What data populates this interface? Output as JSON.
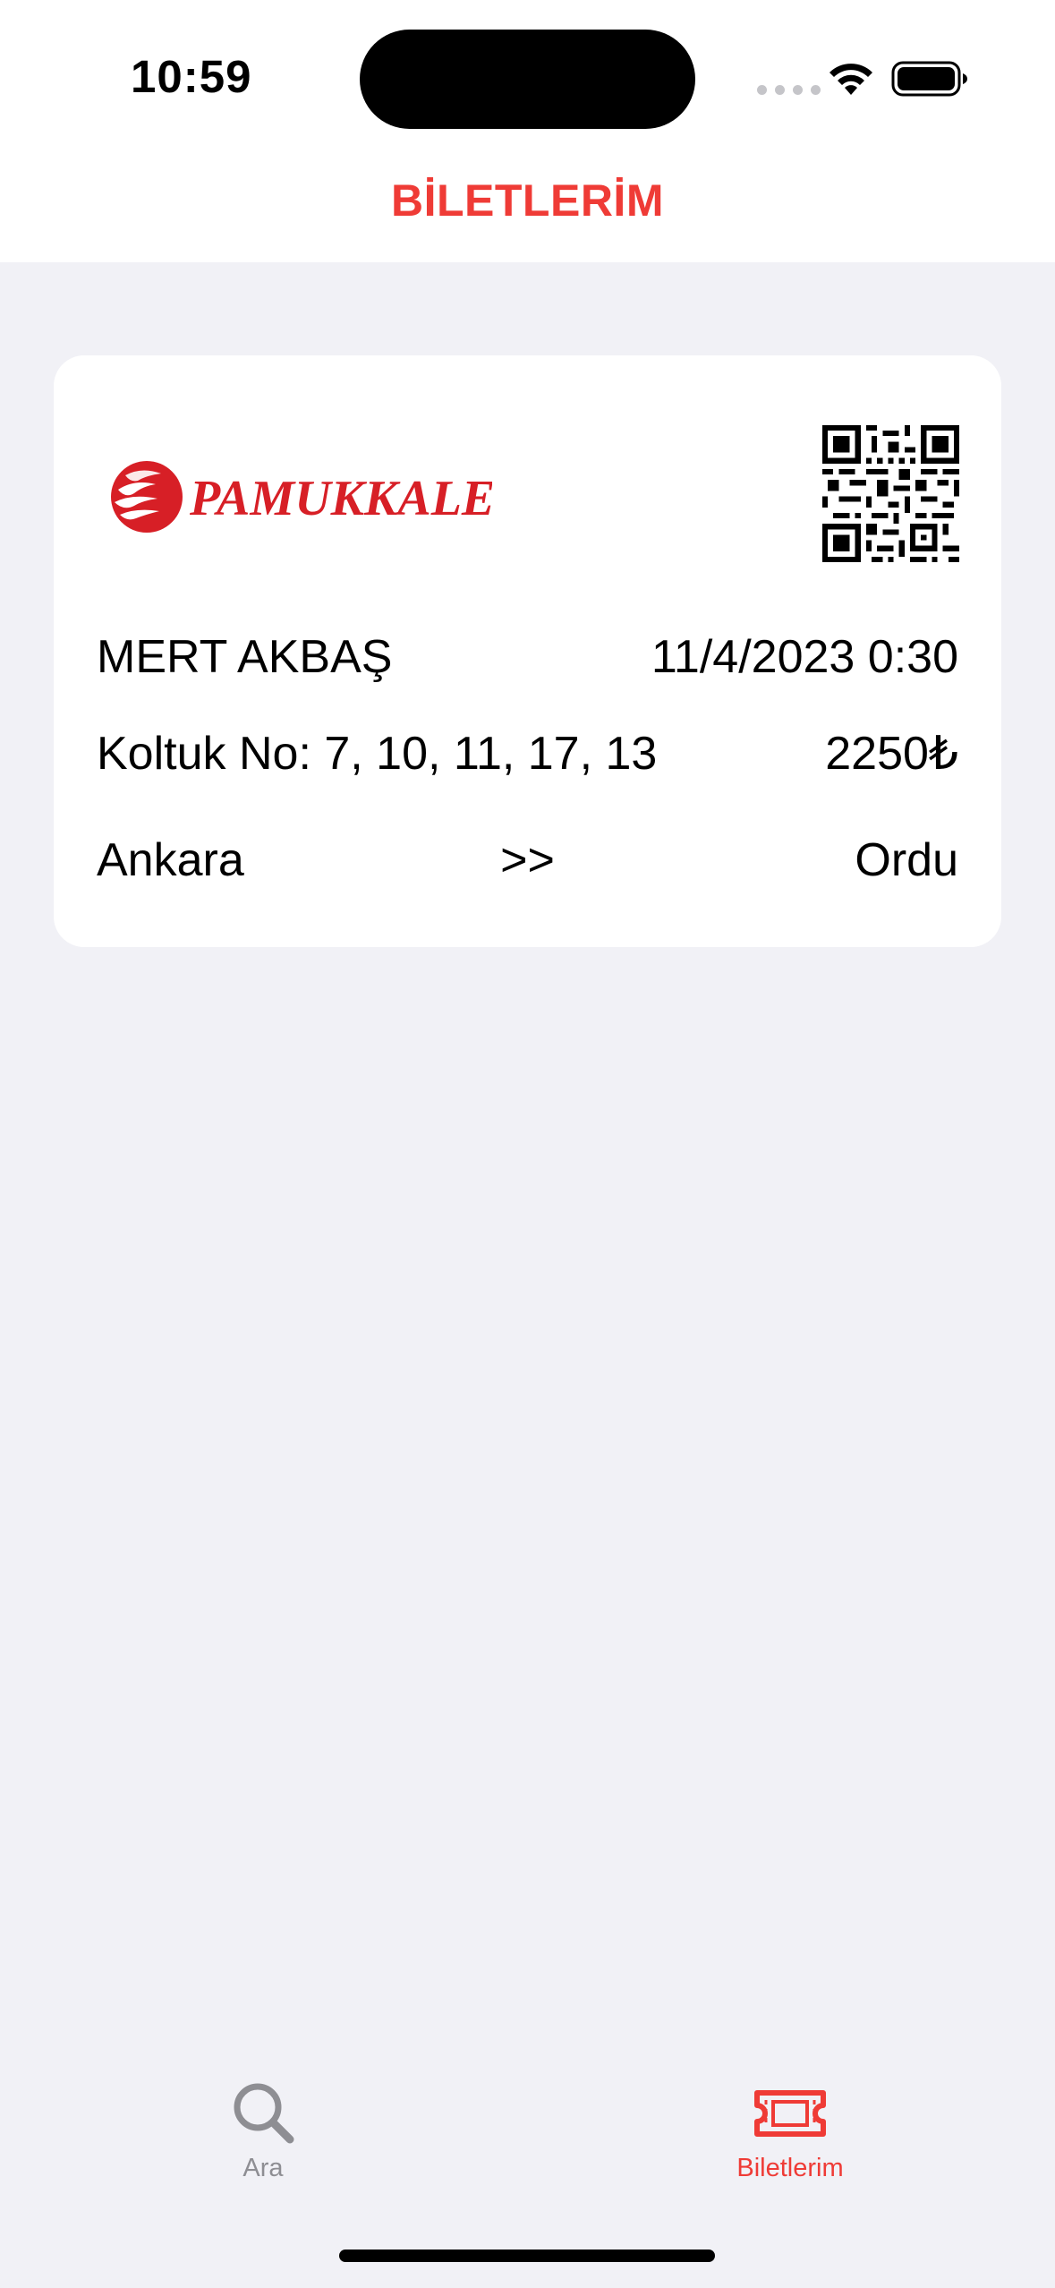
{
  "status_bar": {
    "time": "10:59"
  },
  "nav": {
    "title": "BİLETLERİM"
  },
  "colors": {
    "accent": "#ef3b36",
    "background": "#f1f1f6",
    "inactive_tab": "#8e8e93"
  },
  "ticket": {
    "brand": "PAMUKKALE",
    "passenger_name": "MERT AKBAŞ",
    "datetime": "11/4/2023 0:30",
    "seats": "Koltuk No: 7, 10, 11, 17, 13",
    "price": "2250₺",
    "origin": "Ankara",
    "route_arrow": ">>",
    "destination": "Ordu"
  },
  "tab_bar": {
    "items": [
      {
        "label": "Ara",
        "icon": "magnifying-glass-icon",
        "selected": false
      },
      {
        "label": "Biletlerim",
        "icon": "ticket-icon",
        "selected": true
      }
    ]
  }
}
